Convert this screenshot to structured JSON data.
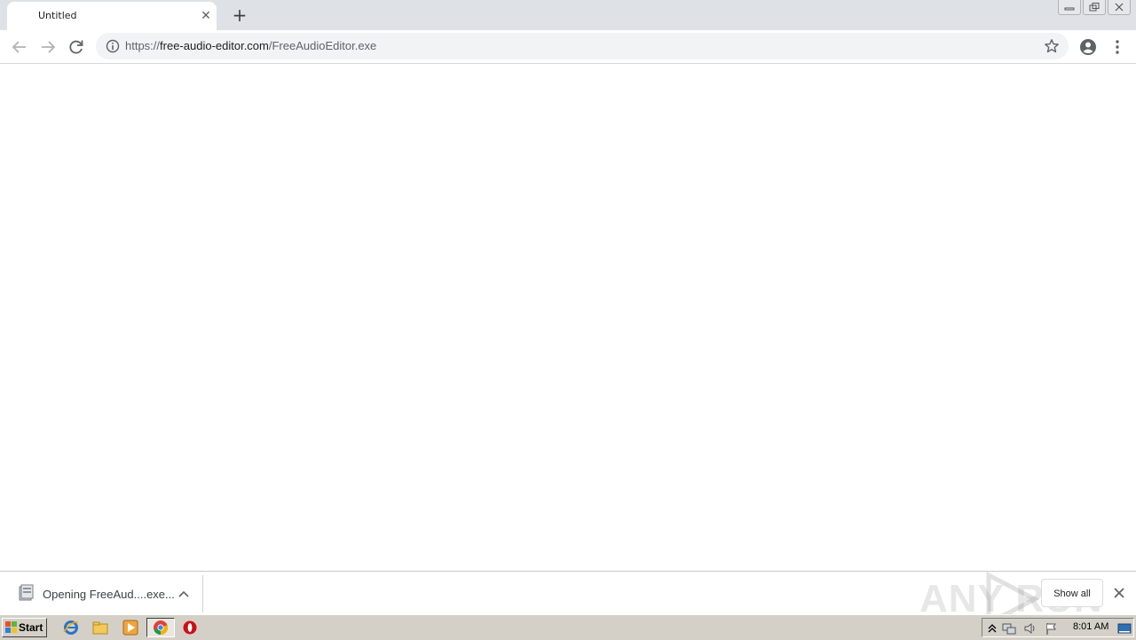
{
  "browser": {
    "tab": {
      "title": "Untitled"
    },
    "address": {
      "scheme": "https://",
      "host": "free-audio-editor.com",
      "path": "/FreeAudioEditor.exe"
    }
  },
  "download_bar": {
    "item_label": "Opening FreeAud....exe...",
    "show_all_label": "Show all"
  },
  "watermark": {
    "text": "ANY RUN"
  },
  "taskbar": {
    "start_label": "Start",
    "clock": "8:01 AM"
  },
  "icons": {
    "tab_close": "close-icon",
    "new_tab": "plus-icon",
    "back": "arrow-left-icon",
    "forward": "arrow-right-icon",
    "reload": "reload-icon",
    "site_info": "info-icon",
    "bookmark": "star-icon",
    "profile": "account-icon",
    "menu": "kebab-menu-icon",
    "download_file": "file-icon",
    "download_options": "chevron-up-icon",
    "download_bar_close": "close-icon"
  },
  "colors": {
    "tabstrip": "#dee1e6",
    "omnibox": "#f1f3f4",
    "taskbar": "#d4d0c8"
  }
}
